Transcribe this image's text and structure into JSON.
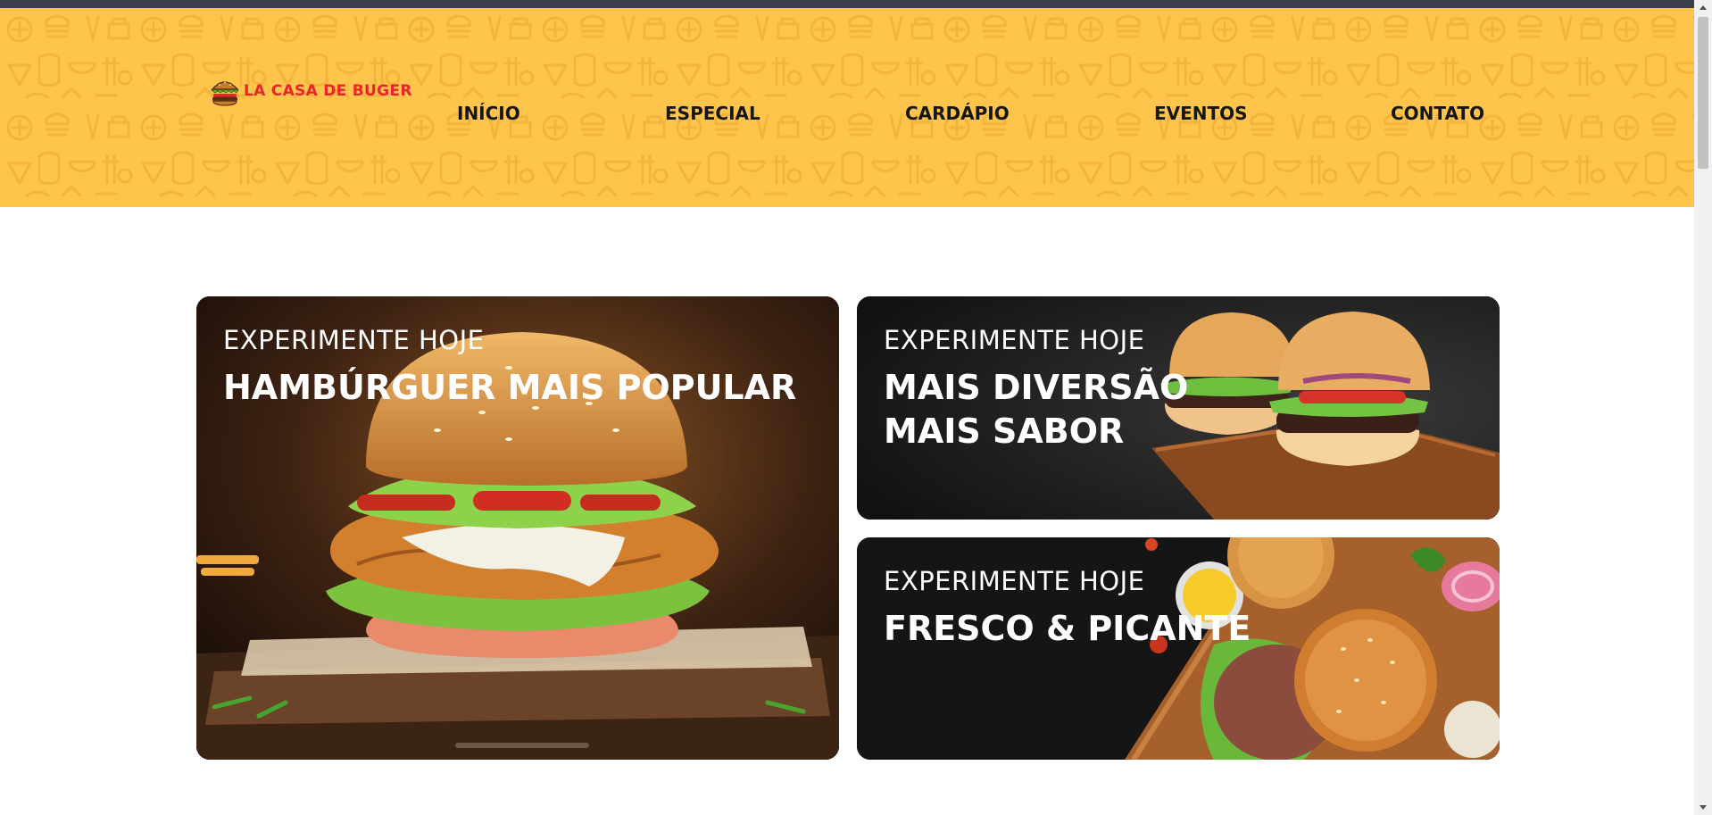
{
  "brand": {
    "name": "LA CASA DE BUGER",
    "logo_icon": "burger-icon"
  },
  "nav": {
    "items": [
      "INÍCIO",
      "ESPECIAL",
      "CARDÁPIO",
      "EVENTOS",
      "CONTATO"
    ]
  },
  "promos": [
    {
      "kicker": "EXPERIMENTE HOJE",
      "headline": [
        "HAMBÚRGUER MAIS POPULAR"
      ]
    },
    {
      "kicker": "EXPERIMENTE HOJE",
      "headline": [
        "MAIS DIVERSÃO",
        "MAIS SABOR"
      ]
    },
    {
      "kicker": "EXPERIMENTE HOJE",
      "headline": [
        "FRESCO & PICANTE"
      ]
    }
  ],
  "colors": {
    "header_bg": "#ffc44c",
    "brand_red": "#e8262a",
    "nav_text": "#161616",
    "card_text": "#ffffff"
  }
}
